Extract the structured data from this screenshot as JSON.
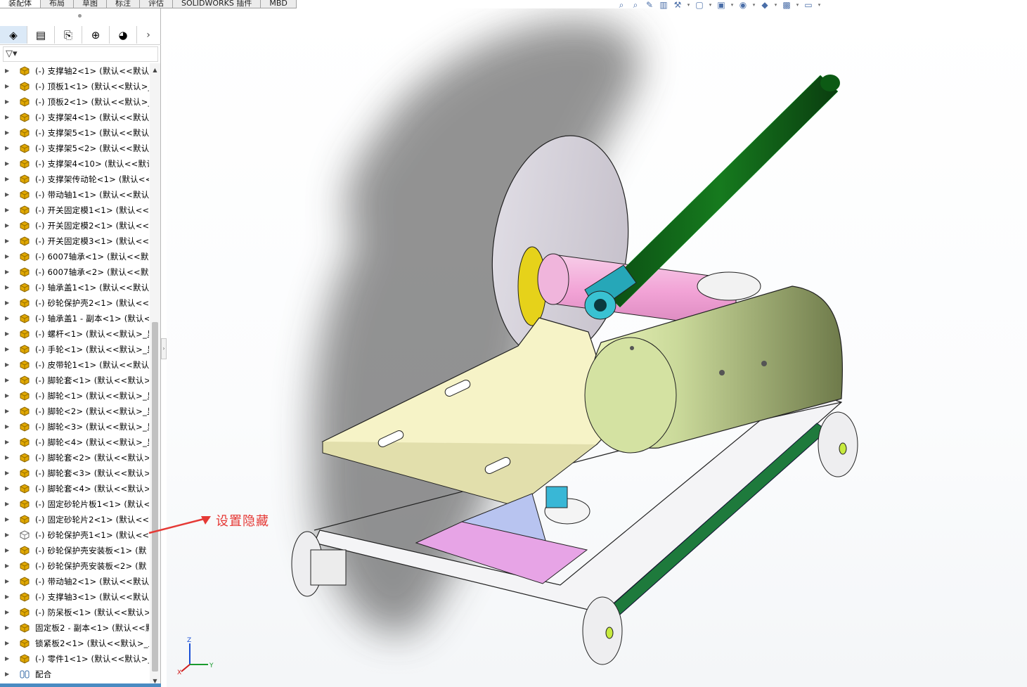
{
  "tabs": [
    "装配体",
    "布局",
    "草图",
    "标注",
    "评估",
    "SOLIDWORKS 插件",
    "MBD"
  ],
  "active_tab": 0,
  "panel_tabs": [
    {
      "name": "feature-manager-tab",
      "glyph": "◈"
    },
    {
      "name": "property-manager-tab",
      "glyph": "▤"
    },
    {
      "name": "configuration-manager-tab",
      "glyph": "⎘"
    },
    {
      "name": "dimxpert-tab",
      "glyph": "⊕"
    },
    {
      "name": "display-manager-tab",
      "glyph": "◕"
    }
  ],
  "panel_more": "›",
  "filter_label": "▽▾",
  "tree_items": [
    "(-) 支撑轴2<1> (默认<<默认",
    "(-) 顶板1<1> (默认<<默认>_",
    "(-) 顶板2<1> (默认<<默认>_",
    "(-) 支撑架4<1> (默认<<默认",
    "(-) 支撑架5<1> (默认<<默认",
    "(-) 支撑架5<2> (默认<<默认",
    "(-) 支撑架4<10> (默认<<默认",
    "(-) 支撑架传动轮<1> (默认<<",
    "(-) 带动轴1<1> (默认<<默认",
    "(-) 开关固定模1<1> (默认<<",
    "(-) 开关固定模2<1> (默认<<",
    "(-) 开关固定模3<1> (默认<<",
    "(-) 6007轴承<1> (默认<<默认",
    "(-) 6007轴承<2> (默认<<默认",
    "(-) 轴承盖1<1> (默认<<默认",
    "(-) 砂轮保护壳2<1> (默认<<",
    "(-) 轴承盖1 - 副本<1> (默认<",
    "(-) 螺杆<1> (默认<<默认>_显",
    "(-) 手轮<1> (默认<<默认>_显",
    "(-) 皮带轮1<1> (默认<<默认",
    "(-) 脚轮套<1> (默认<<默认>",
    "(-) 脚轮<1> (默认<<默认>_显",
    "(-) 脚轮<2> (默认<<默认>_显",
    "(-) 脚轮<3> (默认<<默认>_显",
    "(-) 脚轮<4> (默认<<默认>_显",
    "(-) 脚轮套<2> (默认<<默认>",
    "(-) 脚轮套<3> (默认<<默认>",
    "(-) 脚轮套<4> (默认<<默认>",
    "(-) 固定砂轮片板1<1> (默认<",
    "(-) 固定砂轮片2<1> (默认<<",
    "(-) 砂轮保护壳1<1> (默认<<",
    "(-) 砂轮保护壳安装板<1> (默",
    "(-) 砂轮保护壳安装板<2> (默",
    "(-) 带动轴2<1> (默认<<默认",
    "(-) 支撑轴3<1> (默认<<默认",
    "(-) 防呆板<1> (默认<<默认>",
    "固定板2 - 副本<1> (默认<<默",
    "锁紧板2<1> (默认<<默认>_显",
    "(-) 零件1<1> (默认<<默认>_"
  ],
  "hidden_item_index": 30,
  "mates_label": "配合",
  "annotation": "设置隐藏",
  "hud_icons": [
    "zoom-to-fit-icon",
    "zoom-area-icon",
    "previous-view-icon",
    "section-view-icon",
    "dynamic-annotation-icon",
    "view-orientation-icon",
    "display-style-icon",
    "hide-show-icon",
    "edit-appearance-icon",
    "apply-scene-icon",
    "view-settings-icon"
  ],
  "triad_labels": {
    "x": "X",
    "y": "Y",
    "z": "Z"
  },
  "colors": {
    "accent": "#4a8bc2",
    "part_icon": "#e0a800",
    "annotation": "#e53935"
  }
}
